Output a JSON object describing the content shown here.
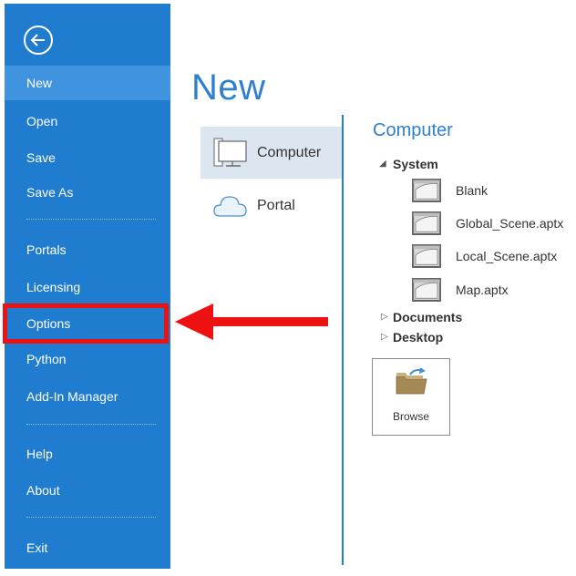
{
  "sidebar": {
    "items": [
      {
        "label": "New",
        "active": true
      },
      {
        "label": "Open"
      },
      {
        "label": "Save"
      },
      {
        "label": "Save As"
      },
      {
        "label": "Portals"
      },
      {
        "label": "Licensing"
      },
      {
        "label": "Options"
      },
      {
        "label": "Python"
      },
      {
        "label": "Add-In Manager"
      },
      {
        "label": "Help"
      },
      {
        "label": "About"
      },
      {
        "label": "Exit"
      }
    ],
    "back_icon": "back-arrow-icon",
    "color": "#1f7ccf"
  },
  "main": {
    "title": "New",
    "locations": [
      {
        "label": "Computer",
        "icon": "computer-icon",
        "selected": true
      },
      {
        "label": "Portal",
        "icon": "cloud-icon"
      }
    ]
  },
  "right": {
    "title": "Computer",
    "tree": {
      "system": "System",
      "files": [
        "Blank",
        "Global_Scene.aptx",
        "Local_Scene.aptx",
        "Map.aptx"
      ],
      "documents": "Documents",
      "desktop": "Desktop"
    },
    "browse_label": "Browse"
  },
  "annotation": {
    "highlight_color": "#ee1111"
  }
}
